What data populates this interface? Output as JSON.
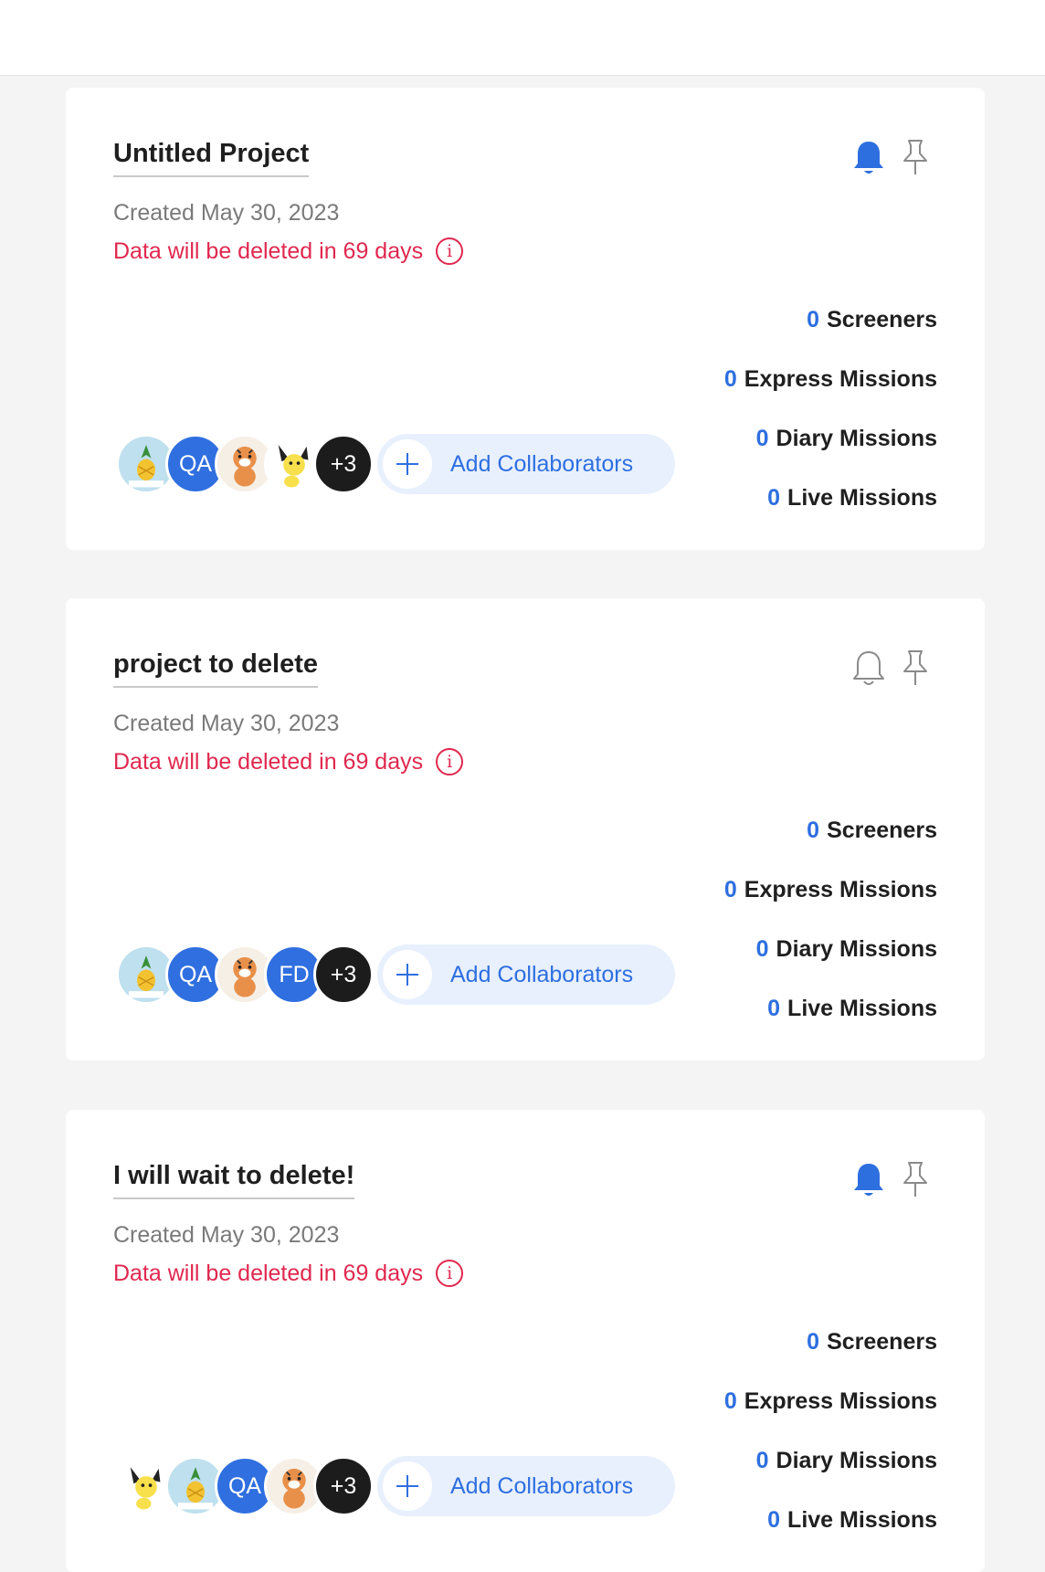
{
  "colors": {
    "accent": "#2e6fe0",
    "warning": "#e0284f",
    "background": "#f4f4f4",
    "card": "#ffffff",
    "add_button_bg": "#e8f0fe"
  },
  "projects": [
    {
      "title": "Untitled Project",
      "created": "Created May 30, 2023",
      "warning": "Data will be deleted in 69 days",
      "notifications_on": true,
      "bell_icon": "bell-filled-icon",
      "pin_icon": "pin-outline-icon",
      "counts": [
        {
          "value": "0",
          "label": "Screeners"
        },
        {
          "value": "0",
          "label": "Express Missions"
        },
        {
          "value": "0",
          "label": "Diary Missions"
        },
        {
          "value": "0",
          "label": "Live Missions"
        }
      ],
      "avatars": [
        "pineapple-avatar",
        "QA",
        "tiger-avatar",
        "pichu-avatar",
        "+3"
      ],
      "add_label": "Add Collaborators"
    },
    {
      "title": "project to delete",
      "created": "Created May 30, 2023",
      "warning": "Data will be deleted in 69 days",
      "notifications_on": false,
      "bell_icon": "bell-outline-icon",
      "pin_icon": "pin-outline-icon",
      "counts": [
        {
          "value": "0",
          "label": "Screeners"
        },
        {
          "value": "0",
          "label": "Express Missions"
        },
        {
          "value": "0",
          "label": "Diary Missions"
        },
        {
          "value": "0",
          "label": "Live Missions"
        }
      ],
      "avatars": [
        "pineapple-avatar",
        "QA",
        "tiger-avatar",
        "FD",
        "+3"
      ],
      "add_label": "Add Collaborators"
    },
    {
      "title": "I will wait to delete!",
      "created": "Created May 30, 2023",
      "warning": "Data will be deleted in 69 days",
      "notifications_on": true,
      "bell_icon": "bell-filled-icon",
      "pin_icon": "pin-outline-icon",
      "counts": [
        {
          "value": "0",
          "label": "Screeners"
        },
        {
          "value": "0",
          "label": "Express Missions"
        },
        {
          "value": "0",
          "label": "Diary Missions"
        },
        {
          "value": "0",
          "label": "Live Missions"
        }
      ],
      "avatars": [
        "pichu-avatar",
        "pineapple-avatar",
        "QA",
        "tiger-avatar",
        "+3"
      ],
      "add_label": "Add Collaborators"
    }
  ]
}
